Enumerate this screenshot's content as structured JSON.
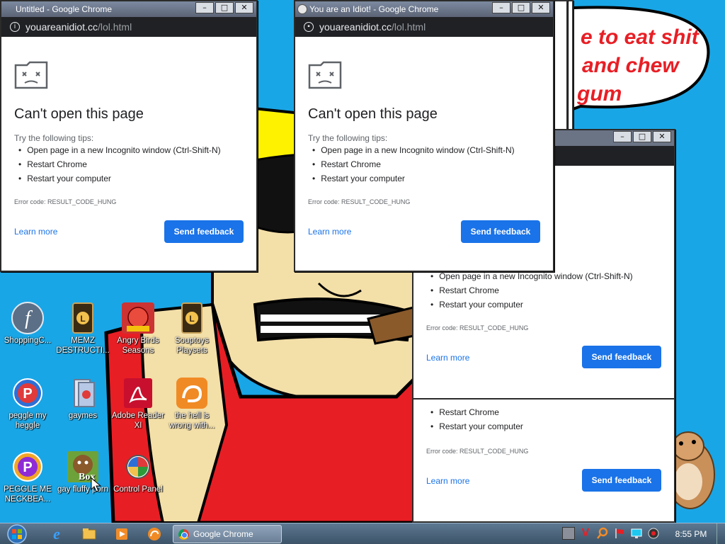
{
  "speech_bubble": {
    "line1": "e to eat shit",
    "line2": "and chew",
    "line3": "gum"
  },
  "error_page": {
    "title": "Can't open this page",
    "subtitle": "Try the following tips:",
    "tips": [
      "Open page in a new Incognito window (Ctrl-Shift-N)",
      "Restart Chrome",
      "Restart your computer"
    ],
    "error_code": "Error code: RESULT_CODE_HUNG",
    "learn_more": "Learn more",
    "send_feedback": "Send feedback"
  },
  "windows": {
    "win1": {
      "title": "Untitled - Google Chrome",
      "url_host": "youareanidiot.cc",
      "url_path": "/lol.html"
    },
    "win2": {
      "title": "You are an Idiot! - Google Chrome",
      "url_host": "youareanidiot.cc",
      "url_path": "/lol.html"
    }
  },
  "window_buttons": {
    "minimize": "–",
    "maximize": "□",
    "close": "✕"
  },
  "desktop_icons": [
    {
      "label": "ShoppingC...",
      "icon": "flash-icon"
    },
    {
      "label": "MEMZ DESTRUCTI...",
      "icon": "memz-icon"
    },
    {
      "label": "Angry Birds Seasons",
      "icon": "angry-birds-icon"
    },
    {
      "label": "Souptoys Playsets",
      "icon": "souptoys-icon"
    },
    {
      "label": "peggle my heggle",
      "icon": "peggle-icon"
    },
    {
      "label": "gaymes",
      "icon": "games-icon"
    },
    {
      "label": "Adobe Reader XI",
      "icon": "adobe-reader-icon"
    },
    {
      "label": "the hell is wrong with...",
      "icon": "uc-browser-icon"
    },
    {
      "label": "PEGGLE ME NECKBEA...",
      "icon": "peggle-icon"
    },
    {
      "label": "gay fluffy porn",
      "icon": "bonzi-icon",
      "badge": "Box"
    },
    {
      "label": "Control Panel",
      "icon": "control-panel-icon"
    }
  ],
  "taskbar": {
    "active_task": "Google Chrome",
    "clock": "8:55 PM"
  },
  "colors": {
    "desktop": "#19a6e6",
    "chrome_blue": "#1a73e8",
    "urlbar": "#202124"
  }
}
